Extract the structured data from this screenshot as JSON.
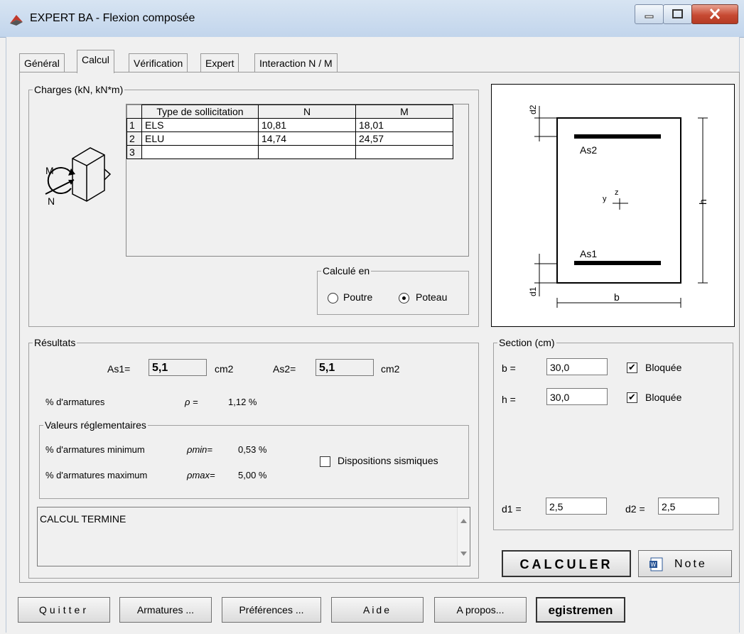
{
  "window": {
    "title": "EXPERT BA - Flexion composée"
  },
  "tabs": [
    {
      "label": "Général"
    },
    {
      "label": "Calcul"
    },
    {
      "label": "Vérification"
    },
    {
      "label": "Expert"
    },
    {
      "label": "Interaction N / M"
    }
  ],
  "charges": {
    "legend": "Charges (kN, kN*m)",
    "headers": [
      "Type de sollicitation",
      "N",
      "M"
    ],
    "rows": [
      {
        "num": "1",
        "type": "ELS",
        "n": "10,81",
        "m": "18,01"
      },
      {
        "num": "2",
        "type": "ELU",
        "n": "14,74",
        "m": "24,57"
      },
      {
        "num": "3",
        "type": "",
        "n": "",
        "m": ""
      }
    ],
    "icon_labels": {
      "m": "M",
      "n": "N"
    }
  },
  "calcule_en": {
    "legend": "Calculé en",
    "poutre": "Poutre",
    "poteau": "Poteau",
    "selected": "Poteau"
  },
  "diagram": {
    "d2": "d2",
    "d1": "d1",
    "as2": "As2",
    "as1": "As1",
    "h": "h",
    "b": "b",
    "y": "y",
    "z": "z"
  },
  "resultats": {
    "legend": "Résultats",
    "as1_label": "As1=",
    "as1_value": "5,1",
    "as1_unit": "cm2",
    "as2_label": "As2=",
    "as2_value": "5,1",
    "as2_unit": "cm2",
    "pct_label": "% d'armatures",
    "rho_label": "ρ =",
    "rho_value": "1,12 %",
    "reg_legend": "Valeurs réglementaires",
    "min_label": "% d'armatures minimum",
    "rho_min_label": "ρmin=",
    "rho_min_value": "0,53 %",
    "max_label": "% d'armatures maximum",
    "rho_max_label": "ρmax=",
    "rho_max_value": "5,00 %",
    "sismique_label": "Dispositions sismiques",
    "sismique_checked": false,
    "status_text": "CALCUL TERMINE"
  },
  "section": {
    "legend": "Section (cm)",
    "b_label": "b =",
    "b_value": "30,0",
    "b_locked_label": "Bloquée",
    "b_locked": true,
    "h_label": "h =",
    "h_value": "30,0",
    "h_locked_label": "Bloquée",
    "h_locked": true,
    "d1_label": "d1 =",
    "d1_value": "2,5",
    "d2_label": "d2 =",
    "d2_value": "2,5"
  },
  "actions": {
    "calculer": "CALCULER",
    "note": "Note"
  },
  "footer": {
    "quitter": "Quitter",
    "armatures": "Armatures ...",
    "preferences": "Préférences ...",
    "aide": "Aide",
    "apropos": "A propos...",
    "enregistrement": "egistremen"
  },
  "colors": {
    "title_bar": "#c2d5ec",
    "close_button": "#c74a33",
    "panel_bg": "#f0f0f0"
  }
}
